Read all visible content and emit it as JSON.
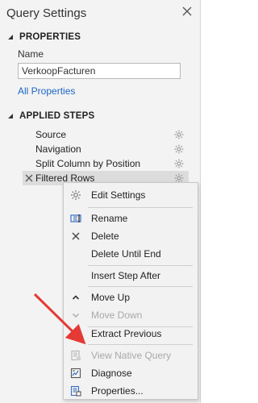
{
  "panel": {
    "title": "Query Settings",
    "close_icon": "close-icon"
  },
  "properties": {
    "header": "PROPERTIES",
    "name_label": "Name",
    "name_value": "VerkoopFacturen",
    "all_properties_link": "All Properties"
  },
  "applied_steps": {
    "header": "APPLIED STEPS",
    "items": [
      {
        "label": "Source",
        "icon": "gear-icon"
      },
      {
        "label": "Navigation",
        "icon": "gear-icon"
      },
      {
        "label": "Split Column by Position",
        "icon": "gear-icon"
      },
      {
        "label": "Filtered Rows",
        "icon": "gear-icon",
        "active": true
      }
    ]
  },
  "context_menu": {
    "items": [
      {
        "label": "Edit Settings",
        "icon": "gear-icon",
        "enabled": true
      },
      {
        "label": "Rename",
        "icon": "rename-icon",
        "enabled": true
      },
      {
        "label": "Delete",
        "icon": "close-icon",
        "enabled": true
      },
      {
        "label": "Delete Until End",
        "icon": "",
        "enabled": true
      },
      {
        "label": "Insert Step After",
        "icon": "",
        "enabled": true
      },
      {
        "label": "Move Up",
        "icon": "chevron-up-icon",
        "enabled": true
      },
      {
        "label": "Move Down",
        "icon": "chevron-down-icon",
        "enabled": false
      },
      {
        "label": "Extract Previous",
        "icon": "",
        "enabled": true
      },
      {
        "label": "View Native Query",
        "icon": "native-query-icon",
        "enabled": false
      },
      {
        "label": "Diagnose",
        "icon": "diagnose-icon",
        "enabled": true
      },
      {
        "label": "Properties...",
        "icon": "properties-icon",
        "enabled": true
      }
    ]
  },
  "colors": {
    "link": "#1a66c4",
    "annotation_arrow": "#e53935",
    "disabled_text": "#a8a8a8"
  }
}
